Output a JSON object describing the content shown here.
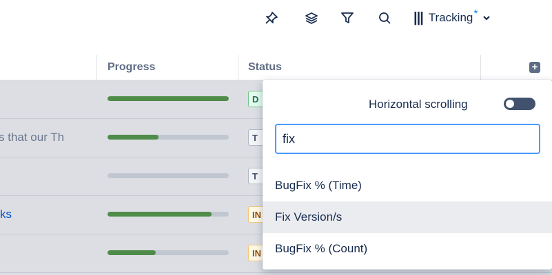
{
  "toolbar": {
    "icons": [
      "pin-icon",
      "layers-icon",
      "filter-icon",
      "search-icon"
    ],
    "tracking": {
      "bars": "|||",
      "label": "Tracking",
      "modified_marker": "*"
    }
  },
  "columns": {
    "progress": "Progress",
    "status": "Status"
  },
  "rows": [
    {
      "text": "",
      "link": false,
      "progress": 1.0,
      "status": "D",
      "status_kind": "done"
    },
    {
      "text": "s that our Th",
      "link": false,
      "progress": 0.42,
      "status": "T",
      "status_kind": "todo"
    },
    {
      "text": "",
      "link": false,
      "progress": 0.0,
      "status": "T",
      "status_kind": "todo"
    },
    {
      "text": "ks",
      "link": true,
      "progress": 0.86,
      "status": "IN",
      "status_kind": "inprogress"
    },
    {
      "text": "",
      "link": false,
      "progress": 0.4,
      "status": "IN",
      "status_kind": "inprogress"
    }
  ],
  "popup": {
    "horizontal_scrolling_label": "Horizontal scrolling",
    "horizontal_scrolling_on": false,
    "search_value": "fix",
    "options": [
      "BugFix % (Time)",
      "Fix Version/s",
      "BugFix % (Count)"
    ],
    "hovered_option_index": 1
  },
  "colors": {
    "progress_fill": "#4f8c4a",
    "focus_border": "#4c9aff",
    "link": "#0052cc"
  }
}
